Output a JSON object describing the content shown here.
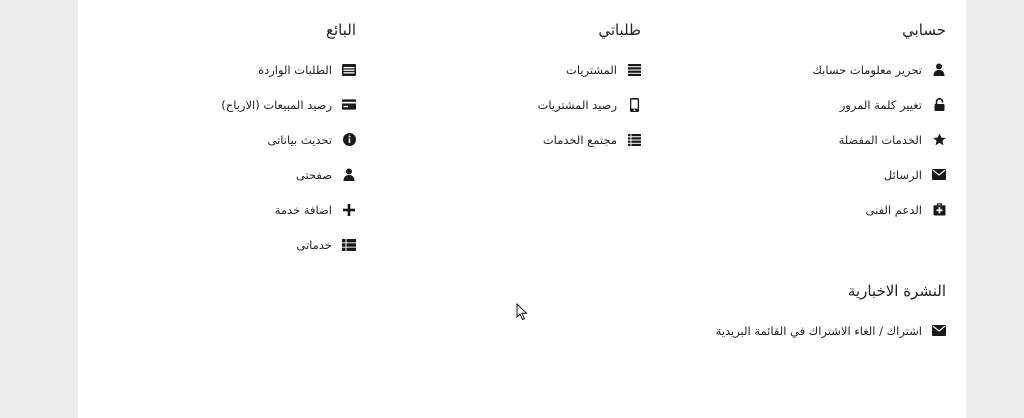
{
  "account": {
    "title": "حسابي",
    "items": [
      {
        "label": "تحرير معلومات حسابك",
        "icon": "user-icon"
      },
      {
        "label": "تغيير كلمة المرور",
        "icon": "lock-icon"
      },
      {
        "label": "الخدمات المفضلة",
        "icon": "star-icon"
      },
      {
        "label": "الرسائل",
        "icon": "envelope-icon"
      },
      {
        "label": "الدعم الفنى",
        "icon": "medkit-icon"
      }
    ]
  },
  "orders": {
    "title": "طلباتي",
    "items": [
      {
        "label": "المشتريات",
        "icon": "list-icon"
      },
      {
        "label": "رصيد المشتريات",
        "icon": "mobile-icon"
      },
      {
        "label": "مجتمع الخدمات",
        "icon": "list-bullets-icon"
      }
    ]
  },
  "seller": {
    "title": "البائع",
    "items": [
      {
        "label": "الطلبات الواردة",
        "icon": "inbox-list-icon"
      },
      {
        "label": "رصيد المبيعات (الارباح)",
        "icon": "credit-card-icon"
      },
      {
        "label": "تحديث بياناتى",
        "icon": "info-icon"
      },
      {
        "label": "صفحتى",
        "icon": "user-icon"
      },
      {
        "label": "اضافة خدمة",
        "icon": "plus-icon"
      },
      {
        "label": "خدماتى",
        "icon": "th-list-icon"
      }
    ]
  },
  "newsletter": {
    "title": "النشرة الاخبارية",
    "item": {
      "label": "اشتراك / الغاء الاشتراك في القائمة البريدية",
      "icon": "envelope-icon"
    }
  },
  "colors": {
    "icon": "#1a1a1a",
    "gutter": "#ececec",
    "background": "#ffffff"
  }
}
